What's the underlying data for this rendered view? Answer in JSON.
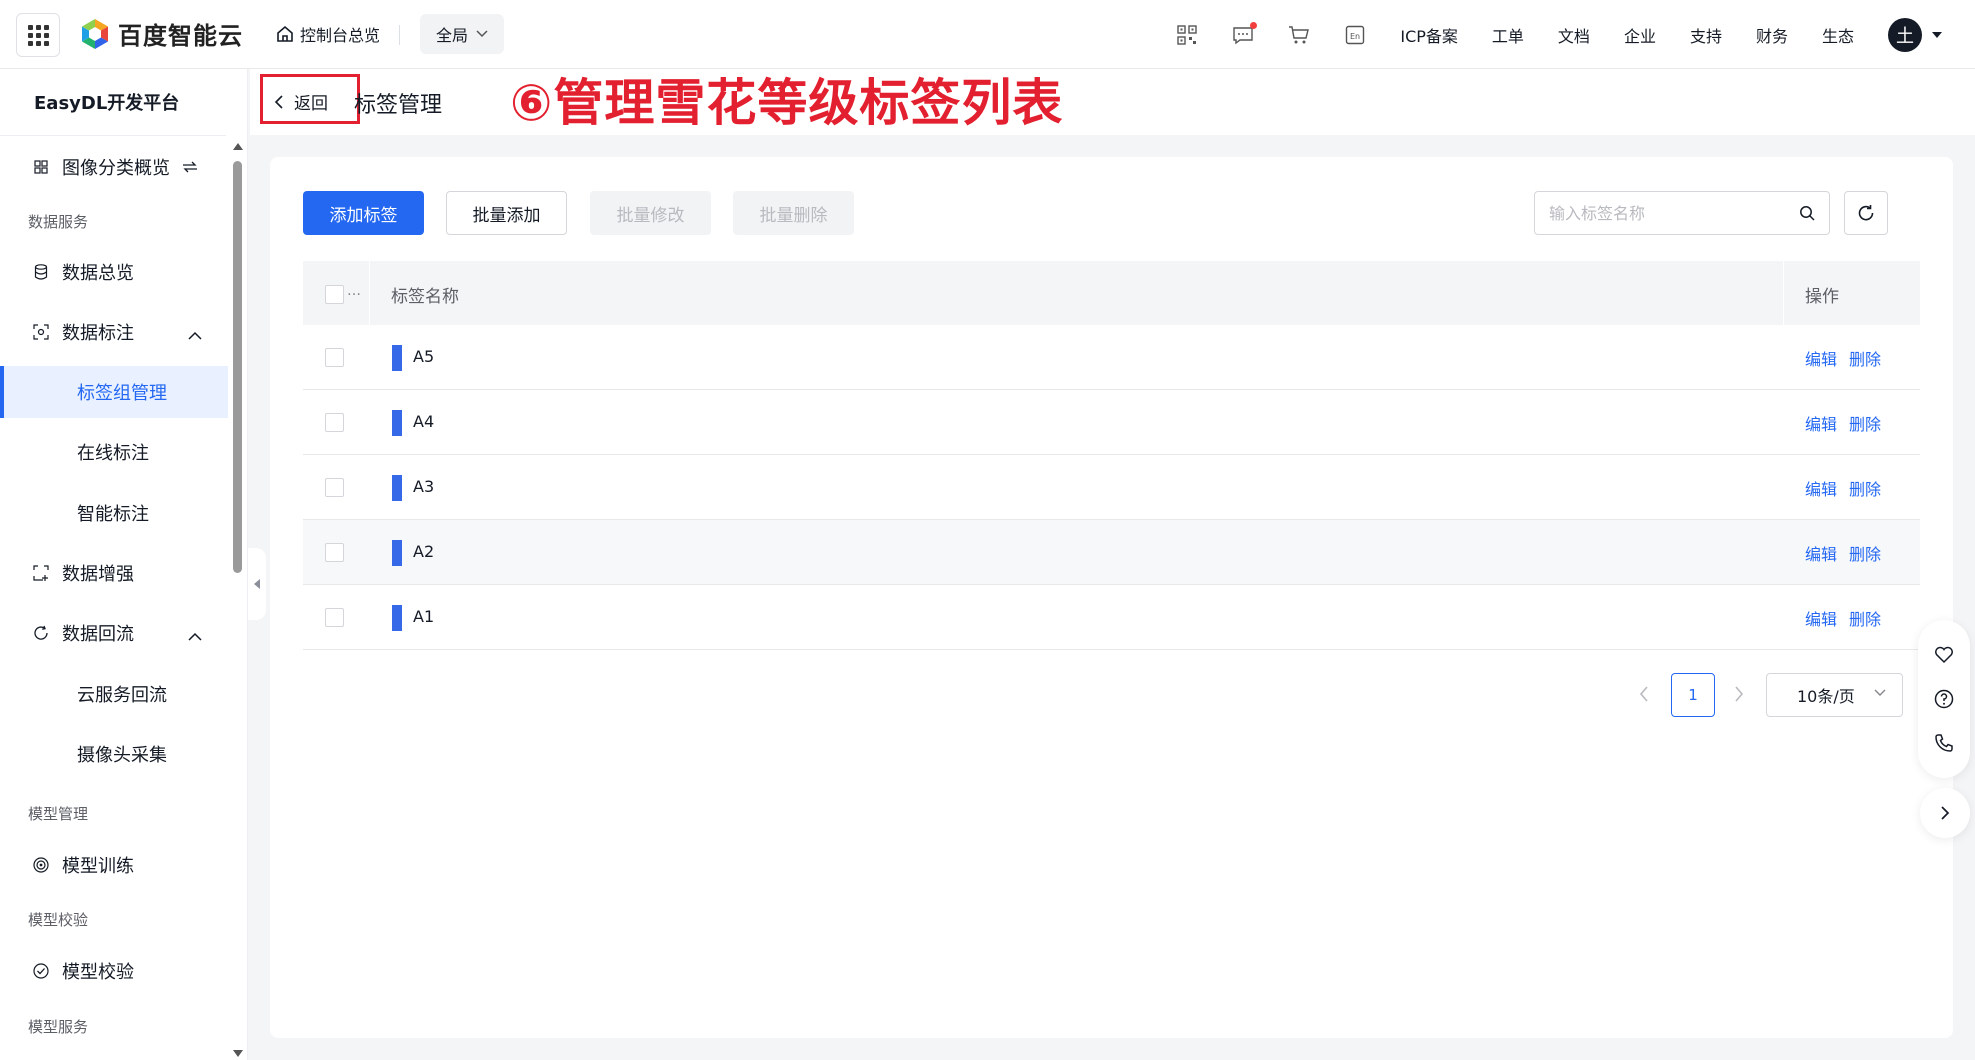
{
  "topbar": {
    "logo_text": "百度智能云",
    "console_home": "控制台总览",
    "region": "全局",
    "links": [
      "ICP备案",
      "工单",
      "文档",
      "企业",
      "支持",
      "财务",
      "生态"
    ],
    "avatar_letter": "土",
    "icons": [
      "qrcode-icon",
      "message-icon",
      "cart-icon",
      "language-icon"
    ]
  },
  "sidebar": {
    "title": "EasyDL开发平台",
    "overview": "图像分类概览",
    "group_data_service": "数据服务",
    "data_overview": "数据总览",
    "data_label": "数据标注",
    "label_group_mgmt": "标签组管理",
    "online_label": "在线标注",
    "smart_label": "智能标注",
    "data_augment": "数据增强",
    "data_backflow": "数据回流",
    "cloud_backflow": "云服务回流",
    "camera_collect": "摄像头采集",
    "group_model_mgmt": "模型管理",
    "model_train": "模型训练",
    "group_model_verify": "模型校验",
    "model_verify": "模型校验",
    "group_model_service": "模型服务"
  },
  "header": {
    "back": "返回",
    "title": "标签管理",
    "annotation": "⑥管理雪花等级标签列表"
  },
  "toolbar": {
    "add_label": "添加标签",
    "batch_add": "批量添加",
    "batch_edit": "批量修改",
    "batch_delete": "批量删除",
    "search_placeholder": "输入标签名称"
  },
  "table": {
    "col_name": "标签名称",
    "col_op": "操作",
    "edit": "编辑",
    "delete": "删除",
    "rows": [
      {
        "name": "A5",
        "color": "#3569e8"
      },
      {
        "name": "A4",
        "color": "#3569e8"
      },
      {
        "name": "A3",
        "color": "#3569e8"
      },
      {
        "name": "A2",
        "color": "#3569e8"
      },
      {
        "name": "A1",
        "color": "#3569e8"
      }
    ]
  },
  "pagination": {
    "current_page": "1",
    "page_size": "10条/页"
  },
  "colors": {
    "primary": "#2468f2",
    "annotation_red": "#e3202f"
  }
}
